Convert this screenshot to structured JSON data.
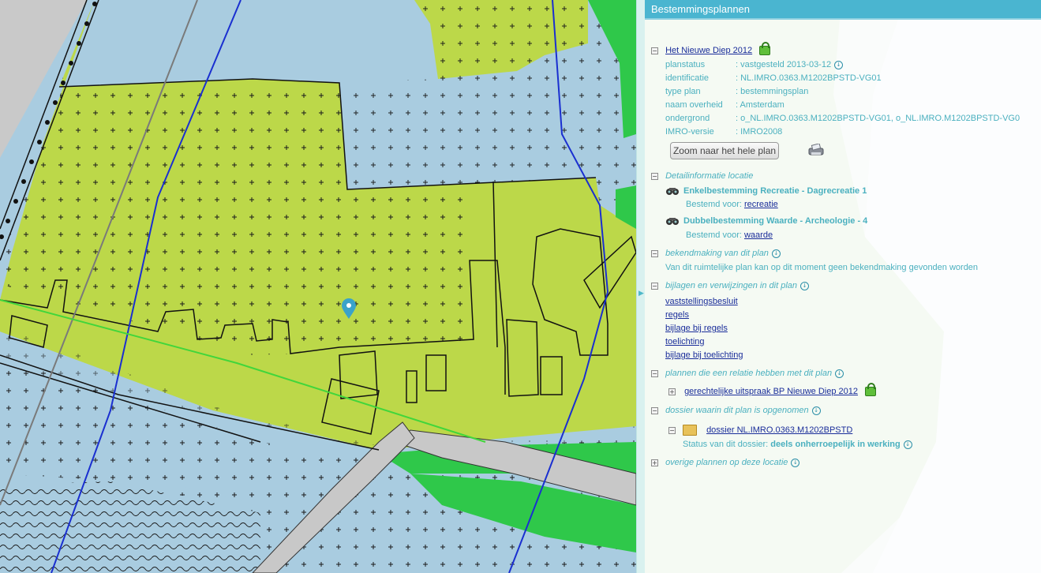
{
  "panel": {
    "title": "Bestemmingsplannen",
    "plan": {
      "name": "Het Nieuwe Diep 2012",
      "fields": [
        {
          "label": "planstatus",
          "value": ": vastgesteld 2013-03-12"
        },
        {
          "label": "identificatie",
          "value": ": NL.IMRO.0363.M1202BPSTD-VG01"
        },
        {
          "label": "type plan",
          "value": ": bestemmingsplan"
        },
        {
          "label": "naam overheid",
          "value": ": Amsterdam"
        },
        {
          "label": "ondergrond",
          "value": ": o_NL.IMRO.0363.M1202BPSTD-VG01, o_NL.IMRO.M1202BPSTD-VG0"
        },
        {
          "label": "IMRO-versie",
          "value": ": IMRO2008"
        }
      ],
      "zoom_button": "Zoom naar het hele plan"
    },
    "detail": {
      "heading": "Detailinformatie locatie",
      "items": [
        {
          "title": "Enkelbestemming Recreatie - Dagrecreatie 1",
          "bestemd_label": "Bestemd voor:",
          "bestemd_value": "recreatie"
        },
        {
          "title": "Dubbelbestemming Waarde - Archeologie - 4",
          "bestemd_label": "Bestemd voor:",
          "bestemd_value": "waarde"
        }
      ]
    },
    "bekendmaking": {
      "heading": "bekendmaking van dit plan",
      "text": "Van dit ruimtelijke plan kan op dit moment geen bekendmaking gevonden worden"
    },
    "bijlagen": {
      "heading": "bijlagen en verwijzingen in dit plan",
      "links": [
        "vaststellingsbesluit",
        "regels",
        "bijlage bij regels",
        "toelichting",
        "bijlage bij toelichting"
      ]
    },
    "relaties": {
      "heading": "plannen die een relatie hebben met dit plan",
      "item": "gerechtelijke uitspraak BP Nieuwe Diep 2012"
    },
    "dossier": {
      "heading": "dossier waarin dit plan is opgenomen",
      "item": "dossier NL.IMRO.0363.M1202BPSTD",
      "status_label": "Status van dit dossier:",
      "status_value": "deels onherroepelijk in werking"
    },
    "overige": {
      "heading": "overige plannen op deze locatie"
    }
  },
  "icons": {
    "toggle_expanded": "minus-box",
    "toggle_collapsed": "plus-box",
    "download": "info-download-icon",
    "lock": "lock-icon",
    "binoculars": "binoculars-icon",
    "folder": "folder-icon",
    "printer": "printer-icon",
    "map_marker": "map-pin-icon"
  },
  "colors": {
    "recreation_green": "#bcd849",
    "water_blue": "#a9cce0",
    "nature_green": "#2fc84a",
    "road_gray": "#c8c8c8",
    "panel_header": "#4ab5d0",
    "link": "#1a2d9a",
    "marker": "#3aa3c9"
  }
}
